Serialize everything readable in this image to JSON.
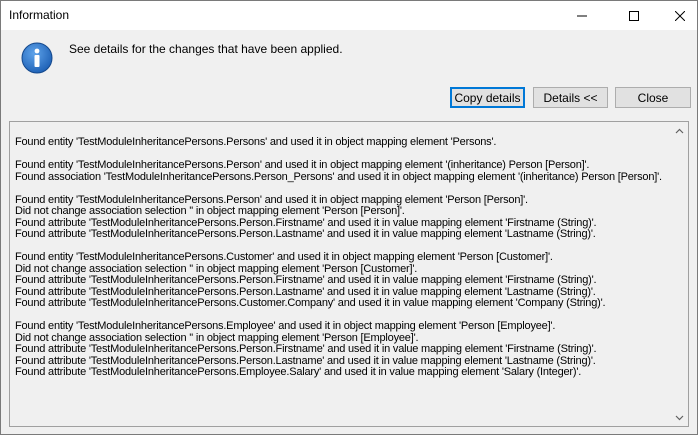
{
  "window": {
    "title": "Information"
  },
  "message": "See details for the changes that have been applied.",
  "buttons": {
    "copy": "Copy details",
    "details": "Details <<",
    "close": "Close"
  },
  "details_lines": [
    "Found entity 'TestModuleInheritancePersons.Persons' and used it in object mapping element 'Persons'.",
    "",
    "Found entity 'TestModuleInheritancePersons.Person' and used it in object mapping element '(inheritance) Person [Person]'.",
    "Found association 'TestModuleInheritancePersons.Person_Persons' and used it in object mapping element '(inheritance) Person [Person]'.",
    "",
    "Found entity 'TestModuleInheritancePersons.Person' and used it in object mapping element 'Person [Person]'.",
    "Did not change association selection '' in object mapping element 'Person [Person]'.",
    "Found attribute 'TestModuleInheritancePersons.Person.Firstname' and used it in value mapping element 'Firstname (String)'.",
    "Found attribute 'TestModuleInheritancePersons.Person.Lastname' and used it in value mapping element 'Lastname (String)'.",
    "",
    "Found entity 'TestModuleInheritancePersons.Customer' and used it in object mapping element 'Person [Customer]'.",
    "Did not change association selection '' in object mapping element 'Person [Customer]'.",
    "Found attribute 'TestModuleInheritancePersons.Person.Firstname' and used it in value mapping element 'Firstname (String)'.",
    "Found attribute 'TestModuleInheritancePersons.Person.Lastname' and used it in value mapping element 'Lastname (String)'.",
    "Found attribute 'TestModuleInheritancePersons.Customer.Company' and used it in value mapping element 'Company (String)'.",
    "",
    "Found entity 'TestModuleInheritancePersons.Employee' and used it in object mapping element 'Person [Employee]'.",
    "Did not change association selection '' in object mapping element 'Person [Employee]'.",
    "Found attribute 'TestModuleInheritancePersons.Person.Firstname' and used it in value mapping element 'Firstname (String)'.",
    "Found attribute 'TestModuleInheritancePersons.Person.Lastname' and used it in value mapping element 'Lastname (String)'.",
    "Found attribute 'TestModuleInheritancePersons.Employee.Salary' and used it in value mapping element 'Salary (Integer)'."
  ],
  "icons": {
    "info": "info-icon",
    "minimize": "minimize-icon",
    "maximize": "maximize-icon",
    "close": "close-icon",
    "scroll_up": "chevron-up-icon",
    "scroll_down": "chevron-down-icon"
  },
  "colors": {
    "info_icon": "#1c5fb4",
    "default_button_border": "#0078d7"
  }
}
